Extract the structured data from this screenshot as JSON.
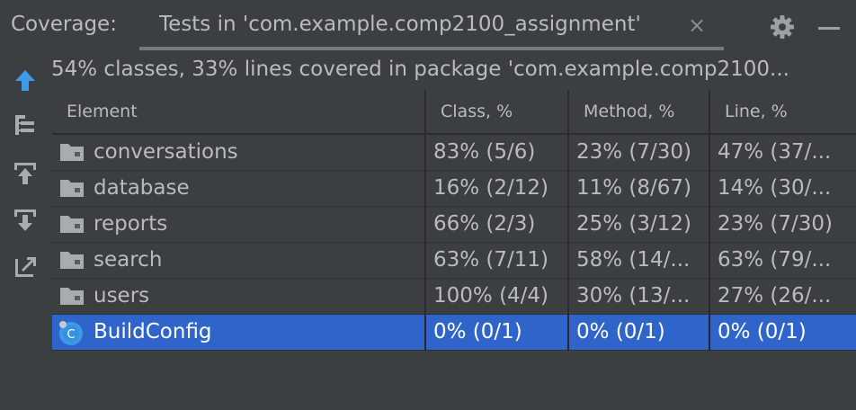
{
  "header": {
    "label": "Coverage:",
    "tab_title": "Tests in 'com.example.comp2100_assignment'",
    "tab_close": "×"
  },
  "toolbar": {
    "icons": [
      "up-arrow-icon",
      "tree-structure-icon",
      "import-icon",
      "export-icon",
      "generate-report-icon"
    ]
  },
  "summary": "54% classes, 33% lines covered in package 'com.example.comp2100...",
  "table": {
    "columns": [
      "Element",
      "Class, %",
      "Method, %",
      "Line, %"
    ],
    "rows": [
      {
        "name": "conversations",
        "type": "folder",
        "class": "83% (5/6)",
        "method": "23% (7/30)",
        "line": "47% (37/..."
      },
      {
        "name": "database",
        "type": "folder",
        "class": "16% (2/12)",
        "method": "11% (8/67)",
        "line": "14% (30/..."
      },
      {
        "name": "reports",
        "type": "folder",
        "class": "66% (2/3)",
        "method": "25% (3/12)",
        "line": "23% (7/30)"
      },
      {
        "name": "search",
        "type": "folder",
        "class": "63% (7/11)",
        "method": "58% (14/...",
        "line": "63% (79/..."
      },
      {
        "name": "users",
        "type": "folder",
        "class": "100% (4/4)",
        "method": "30% (13/...",
        "line": "27% (26/..."
      },
      {
        "name": "BuildConfig",
        "type": "class",
        "class": "0% (0/1)",
        "method": "0% (0/1)",
        "line": "0% (0/1)",
        "selected": true
      }
    ]
  },
  "colors": {
    "background": "#3c3f41",
    "selection": "#2f65ca",
    "accent_arrow": "#3d9ae8"
  }
}
